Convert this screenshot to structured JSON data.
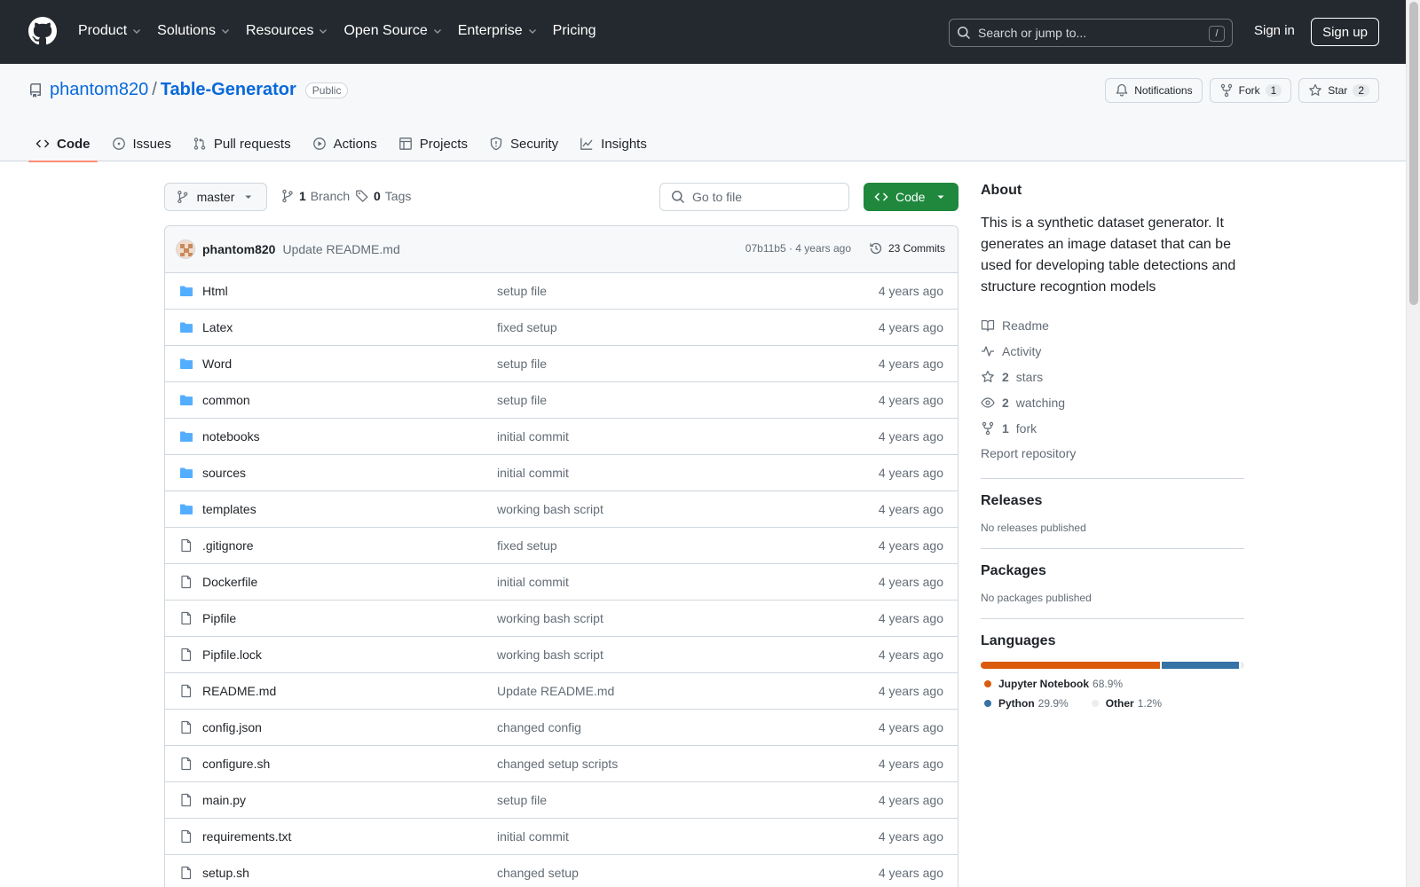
{
  "header": {
    "nav": [
      "Product",
      "Solutions",
      "Resources",
      "Open Source",
      "Enterprise",
      "Pricing"
    ],
    "search_placeholder": "Search or jump to...",
    "search_shortcut": "/",
    "sign_in": "Sign in",
    "sign_up": "Sign up"
  },
  "repo": {
    "owner": "phantom820",
    "separator": "/",
    "name": "Table-Generator",
    "visibility": "Public",
    "notifications_label": "Notifications",
    "fork_label": "Fork",
    "fork_count": "1",
    "star_label": "Star",
    "star_count": "2"
  },
  "tabs": [
    {
      "label": "Code",
      "icon": "code-icon",
      "active": true
    },
    {
      "label": "Issues",
      "icon": "issue-icon"
    },
    {
      "label": "Pull requests",
      "icon": "pull-request-icon"
    },
    {
      "label": "Actions",
      "icon": "play-icon"
    },
    {
      "label": "Projects",
      "icon": "table-icon"
    },
    {
      "label": "Security",
      "icon": "shield-icon"
    },
    {
      "label": "Insights",
      "icon": "graph-icon"
    }
  ],
  "toolbar": {
    "branch": "master",
    "branch_count": "1",
    "branch_label": "Branch",
    "tag_count": "0",
    "tag_label": "Tags",
    "goto_placeholder": "Go to file",
    "code_label": "Code"
  },
  "commit": {
    "author": "phantom820",
    "message": "Update README.md",
    "meta": "07b11b5 · 4 years ago",
    "count_label": "23 Commits"
  },
  "files": [
    {
      "type": "dir",
      "name": "Html",
      "msg": "setup file",
      "age": "4 years ago"
    },
    {
      "type": "dir",
      "name": "Latex",
      "msg": "fixed setup",
      "age": "4 years ago"
    },
    {
      "type": "dir",
      "name": "Word",
      "msg": "setup file",
      "age": "4 years ago"
    },
    {
      "type": "dir",
      "name": "common",
      "msg": "setup file",
      "age": "4 years ago"
    },
    {
      "type": "dir",
      "name": "notebooks",
      "msg": "initial commit",
      "age": "4 years ago"
    },
    {
      "type": "dir",
      "name": "sources",
      "msg": "initial commit",
      "age": "4 years ago"
    },
    {
      "type": "dir",
      "name": "templates",
      "msg": "working bash script",
      "age": "4 years ago"
    },
    {
      "type": "file",
      "name": ".gitignore",
      "msg": "fixed setup",
      "age": "4 years ago"
    },
    {
      "type": "file",
      "name": "Dockerfile",
      "msg": "initial commit",
      "age": "4 years ago"
    },
    {
      "type": "file",
      "name": "Pipfile",
      "msg": "working bash script",
      "age": "4 years ago"
    },
    {
      "type": "file",
      "name": "Pipfile.lock",
      "msg": "working bash script",
      "age": "4 years ago"
    },
    {
      "type": "file",
      "name": "README.md",
      "msg": "Update README.md",
      "age": "4 years ago"
    },
    {
      "type": "file",
      "name": "config.json",
      "msg": "changed config",
      "age": "4 years ago"
    },
    {
      "type": "file",
      "name": "configure.sh",
      "msg": "changed setup scripts",
      "age": "4 years ago"
    },
    {
      "type": "file",
      "name": "main.py",
      "msg": "setup file",
      "age": "4 years ago"
    },
    {
      "type": "file",
      "name": "requirements.txt",
      "msg": "initial commit",
      "age": "4 years ago"
    },
    {
      "type": "file",
      "name": "setup.sh",
      "msg": "changed setup",
      "age": "4 years ago"
    }
  ],
  "about": {
    "title": "About",
    "description": "This is a synthetic dataset generator. It generates an image dataset that can be used for developing table detections and structure recogntion models",
    "readme": "Readme",
    "activity": "Activity",
    "stars_count": "2",
    "stars_label": "stars",
    "watching_count": "2",
    "watching_label": "watching",
    "fork_count": "1",
    "fork_label": "fork",
    "report": "Report repository"
  },
  "releases": {
    "title": "Releases",
    "empty": "No releases published"
  },
  "packages": {
    "title": "Packages",
    "empty": "No packages published"
  },
  "languages": {
    "title": "Languages",
    "items": [
      {
        "name": "Jupyter Notebook",
        "pct": "68.9%",
        "value": 68.9,
        "color": "#DA5B0B"
      },
      {
        "name": "Python",
        "pct": "29.9%",
        "value": 29.9,
        "color": "#3572A5"
      },
      {
        "name": "Other",
        "pct": "1.2%",
        "value": 1.2,
        "color": "#ededed"
      }
    ]
  },
  "colors": {
    "header_bg": "#24292f",
    "link": "#0969da",
    "primary_button": "#1f883d",
    "active_tab_underline": "#fd8c73",
    "folder": "#54aeff"
  }
}
